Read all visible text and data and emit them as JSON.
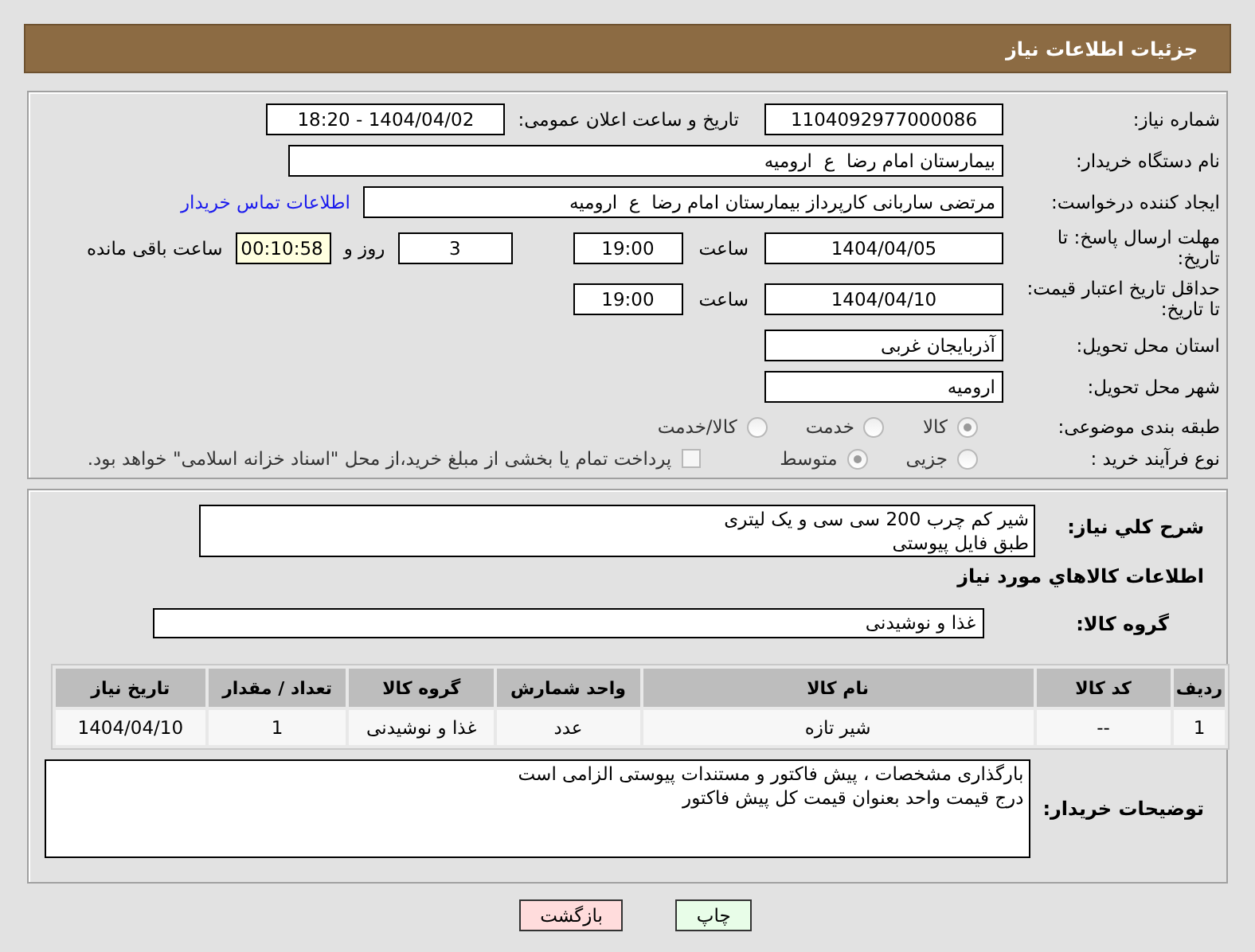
{
  "header": {
    "title": "جزئیات اطلاعات نیاز"
  },
  "need_number": {
    "label": "شماره نیاز:",
    "value": "1104092977000086"
  },
  "announce": {
    "label": "تاریخ و ساعت اعلان عمومی:",
    "value": "1404/04/02 - 18:20"
  },
  "buyer_org": {
    "label": "نام دستگاه خریدار:",
    "value": "بیمارستان امام رضا  ع  ارومیه"
  },
  "requester": {
    "label": "ایجاد کننده درخواست:",
    "value": "مرتضی ساربانی کارپرداز بیمارستان امام رضا  ع  ارومیه",
    "link": "اطلاعات تماس خریدار"
  },
  "reply_deadline": {
    "label": "مهلت ارسال پاسخ: تا تاریخ:",
    "date": "1404/04/05",
    "time_label": "ساعت",
    "time": "19:00",
    "days": "3",
    "days_label": "روز و",
    "remaining": "00:10:58",
    "remaining_label": "ساعت باقی مانده"
  },
  "price_validity": {
    "label": "حداقل تاریخ اعتبار قیمت: تا تاریخ:",
    "date": "1404/04/10",
    "time_label": "ساعت",
    "time": "19:00"
  },
  "province": {
    "label": "استان محل تحویل:",
    "value": "آذربایجان غربی"
  },
  "city": {
    "label": "شهر محل تحویل:",
    "value": "ارومیه"
  },
  "category": {
    "label": "طبقه بندی موضوعی:",
    "options": [
      {
        "label": "کالا",
        "selected": true
      },
      {
        "label": "خدمت",
        "selected": false
      },
      {
        "label": "کالا/خدمت",
        "selected": false
      }
    ]
  },
  "process": {
    "label": "نوع فرآیند خرید :",
    "options": [
      {
        "label": "جزیی",
        "selected": false
      },
      {
        "label": "متوسط",
        "selected": true
      }
    ],
    "payment_note": {
      "label": "پرداخت تمام یا بخشی از مبلغ خرید،از محل \"اسناد خزانه اسلامی\" خواهد بود.",
      "checked": false
    }
  },
  "description": {
    "label": "شرح کلي نیاز:",
    "text": "شیر کم چرب 200 سی سی و یک لیتری\nطبق فایل پیوستی"
  },
  "goods_heading": "اطلاعات کالاهاي مورد نیاز",
  "goods_group": {
    "label": "گروه کالا:",
    "value": "غذا و نوشیدنی"
  },
  "table": {
    "columns": [
      "ردیف",
      "کد کالا",
      "نام کالا",
      "واحد شمارش",
      "گروه کالا",
      "تعداد / مقدار",
      "تاریخ نیاز"
    ],
    "rows": [
      [
        "1",
        "--",
        "شیر تازه",
        "عدد",
        "غذا و نوشیدنی",
        "1",
        "1404/04/10"
      ]
    ]
  },
  "buyer_notes": {
    "label": "توضیحات خریدار:",
    "text": "بارگذاری مشخصات ، پیش فاکتور و مستندات پیوستی الزامی است\nدرج قیمت واحد بعنوان قیمت کل پیش فاکتور"
  },
  "buttons": [
    {
      "label": "چاپ",
      "kind": "print"
    },
    {
      "label": "بازگشت",
      "kind": "back"
    }
  ]
}
